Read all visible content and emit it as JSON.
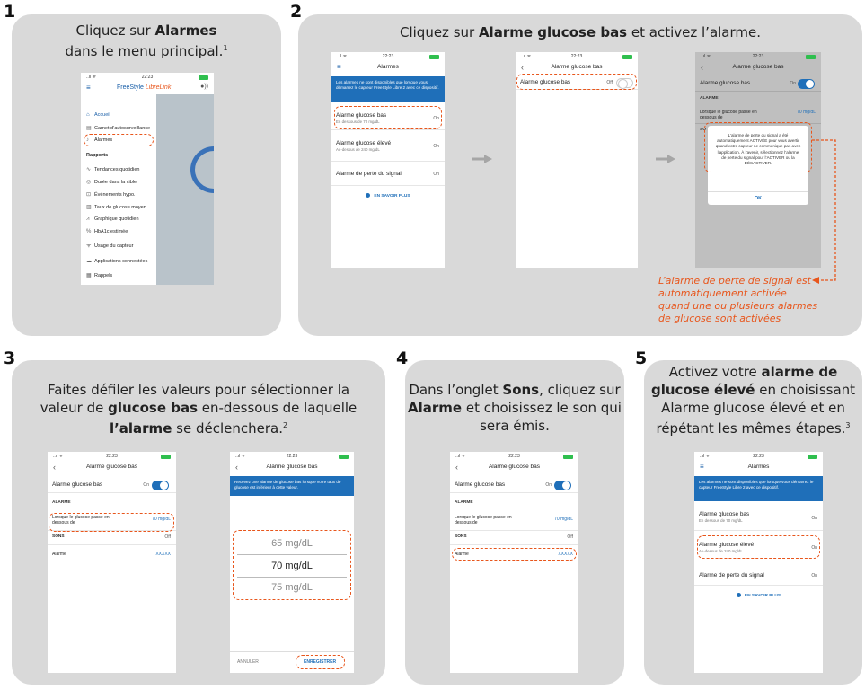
{
  "colors": {
    "accent_blue": "#1f6fb9",
    "highlight_orange": "#e8561c",
    "panel_bg": "#d9d9d9",
    "toggle_on": "#1f6fb9"
  },
  "status_bar": {
    "time": "22:23",
    "signal": "..ıl ᯤ"
  },
  "steps": {
    "s1": {
      "number": "1",
      "title_a": "Cliquez sur ",
      "title_b": "Alarmes",
      "title_c": "dans le menu principal.",
      "title_sup": "1",
      "app_logo_a": "FreeStyle ",
      "app_logo_b": "LibreLink",
      "menu": [
        {
          "icon": "home-icon",
          "glyph": "⌂",
          "label": "Accueil"
        },
        {
          "icon": "logbook-icon",
          "glyph": "▤",
          "label": "Carnet d’autosurveillance"
        },
        {
          "icon": "bell-icon",
          "glyph": "♪",
          "label": "Alarmes"
        }
      ],
      "section_reports": "Rapports",
      "reports": [
        {
          "icon": "trend-icon",
          "glyph": "∿",
          "label": "Tendances quotidien"
        },
        {
          "icon": "target-icon",
          "glyph": "◎",
          "label": "Durée dans la cible"
        },
        {
          "icon": "hypo-icon",
          "glyph": "⊡",
          "label": "Événements hypo."
        },
        {
          "icon": "average-icon",
          "glyph": "▥",
          "label": "Taux de glucose moyen"
        },
        {
          "icon": "graph-icon",
          "glyph": "⩘",
          "label": "Graphique quotidien"
        },
        {
          "icon": "percent-icon",
          "glyph": "%",
          "label": "HbA1c estimée"
        },
        {
          "icon": "sensor-icon",
          "glyph": "ᯤ",
          "label": "Usage du capteur"
        }
      ],
      "more": [
        {
          "icon": "cloud-icon",
          "glyph": "☁",
          "label": "Applications connectées"
        },
        {
          "icon": "calendar-icon",
          "glyph": "▦",
          "label": "Rappels"
        }
      ]
    },
    "s2": {
      "number": "2",
      "title_a": "Cliquez sur ",
      "title_b": "Alarme glucose bas",
      "title_c": " et activez l’alarme.",
      "phoneA": {
        "nav_title": "Alarmes",
        "banner": "Les alarmes ne sont disponibles que lorsque vous démarrez le capteur FreeStyle Libre 2 avec ce dispositif.",
        "rows": [
          {
            "label": "Alarme glucose bas",
            "sub": "En dessous de 70 mg/dL",
            "value": "On"
          },
          {
            "label": "Alarme glucose élevé",
            "sub": "Au-dessus de 240 mg/dL",
            "value": "On"
          },
          {
            "label": "Alarme de perte du signal",
            "sub": "",
            "value": "On"
          }
        ],
        "learn_more": "EN SAVOIR PLUS"
      },
      "phoneB": {
        "nav_title": "Alarme glucose bas",
        "row_label": "Alarme glucose bas",
        "row_value": "Off"
      },
      "phoneC": {
        "nav_title": "Alarme glucose bas",
        "row_label": "Alarme glucose bas",
        "row_value": "On",
        "section": "ALARME",
        "row2_label": "Lorsque le glucose passe en dessous de",
        "row2_value": "70 mg/dL",
        "section2": "SO",
        "dialog_text": "L’alarme de perte du signal a été automatiquement ACTIVÉE pour vous avertir quand votre capteur ne communique pas avec l’application. À l’avenir, sélectionnez l’alarme de perte du signal pour l’ACTIVER ou la DÉSACTIVER.",
        "dialog_ok": "OK"
      },
      "note": "L’alarme de perte de signal est automatiquement activée quand une ou plusieurs alarmes de glucose sont activées"
    },
    "s3": {
      "number": "3",
      "title_a": "Faites défiler les valeurs pour sélectionner la valeur de ",
      "title_b": "glucose bas",
      "title_c": " en-dessous de laquelle ",
      "title_d": "l’alarme",
      "title_e": " se déclenchera.",
      "title_sup": "2",
      "phoneA": {
        "nav_title": "Alarme glucose bas",
        "row_label": "Alarme glucose bas",
        "row_value": "On",
        "section": "ALARME",
        "row2_label": "Lorsque le glucose passe en dessous de",
        "row2_value": "70 mg/dL",
        "section2": "SONS",
        "section2_value": "Off",
        "row3_label": "Alarme",
        "row3_value": "XXXXX"
      },
      "phoneB": {
        "nav_title": "Alarme glucose bas",
        "banner": "Recevez une alarme de glucose bas lorsque votre taux de glucose est inférieur à cette valeur.",
        "values": [
          "65 mg/dL",
          "70 mg/dL",
          "75 mg/dL"
        ],
        "cancel": "ANNULER",
        "save": "ENREGISTRER"
      }
    },
    "s4": {
      "number": "4",
      "title_a": "Dans l’onglet ",
      "title_b": "Sons",
      "title_c": ", cliquez sur ",
      "title_d": "Alarme",
      "title_e": " et choisissez le son qui sera émis.",
      "phone": {
        "nav_title": "Alarme glucose bas",
        "row_label": "Alarme glucose bas",
        "row_value": "On",
        "section": "ALARME",
        "row2_label": "Lorsque le glucose passe en dessous de",
        "row2_value": "70 mg/dL",
        "section2": "SONS",
        "section2_value": "Off",
        "row3_label": "Alarme",
        "row3_value": "XXXXX"
      }
    },
    "s5": {
      "number": "5",
      "title_a": "Activez votre ",
      "title_b": "alarme de glucose élevé",
      "title_c": " en choisissant Alarme glucose élevé et en répétant les mêmes étapes.",
      "title_sup": "3",
      "phone": {
        "nav_title": "Alarmes",
        "banner": "Les alarmes ne sont disponibles que lorsque vous démarrez le capteur FreeStyle Libre 2 avec ce dispositif.",
        "rows": [
          {
            "label": "Alarme glucose bas",
            "sub": "En dessous de 70 mg/dL",
            "value": "On"
          },
          {
            "label": "Alarme glucose élevé",
            "sub": "Au-dessus de 240 mg/dL",
            "value": "On"
          },
          {
            "label": "Alarme de perte du signal",
            "sub": "",
            "value": "On"
          }
        ],
        "learn_more": "EN SAVOIR PLUS"
      }
    }
  }
}
